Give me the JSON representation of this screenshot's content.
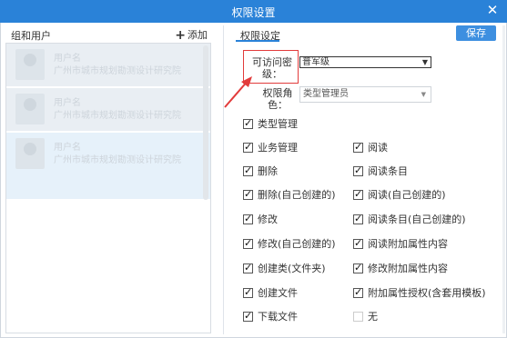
{
  "window": {
    "title": "权限设置",
    "close_icon": "close-icon"
  },
  "left_panel": {
    "tab_label": "组和用户",
    "add_label": "添加",
    "users": [
      {
        "name": "用户名",
        "org": "广州市城市规划勘测设计研究院"
      },
      {
        "name": "用户名",
        "org": "广州市城市规划勘测设计研究院"
      },
      {
        "name": "用户名",
        "org": "广州市城市规划勘测设计研究院"
      }
    ]
  },
  "right_panel": {
    "tab_label": "权限设定",
    "save_label": "保存",
    "access_level_label": "可访问密级：",
    "access_level_value": "普军级",
    "role_label": "权限角色：",
    "role_value": "类型管理员",
    "permissions_left": [
      {
        "label": "类型管理",
        "checked": true
      },
      {
        "label": "业务管理",
        "checked": true
      },
      {
        "label": "删除",
        "checked": true
      },
      {
        "label": "删除(自己创建的)",
        "checked": true
      },
      {
        "label": "修改",
        "checked": true
      },
      {
        "label": "修改(自己创建的)",
        "checked": true
      },
      {
        "label": "创建类(文件夹)",
        "checked": true
      },
      {
        "label": "创建文件",
        "checked": true
      },
      {
        "label": "下载文件",
        "checked": true
      }
    ],
    "permissions_right": [
      {
        "label": "阅读",
        "checked": true
      },
      {
        "label": "阅读条目",
        "checked": true
      },
      {
        "label": "阅读(自己创建的)",
        "checked": true
      },
      {
        "label": "阅读条目(自己创建的)",
        "checked": true
      },
      {
        "label": "阅读附加属性内容",
        "checked": true
      },
      {
        "label": "修改附加属性内容",
        "checked": true
      },
      {
        "label": "附加属性授权(含套用模板)",
        "checked": true
      },
      {
        "label": "无",
        "checked": false
      }
    ]
  },
  "colors": {
    "title_bar": "#2a82d8",
    "accent": "#3d8fe0",
    "highlight_box": "#e23b3b"
  }
}
